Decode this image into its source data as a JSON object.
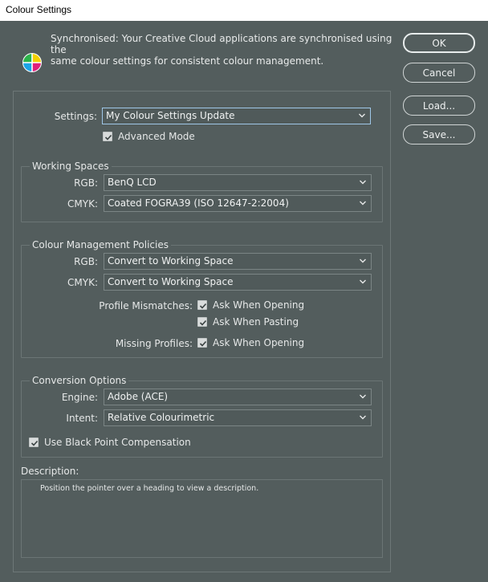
{
  "window": {
    "title": "Colour Settings"
  },
  "sync": {
    "line1": "Synchronised: Your Creative Cloud applications are synchronised using the",
    "line2": "same colour settings for consistent colour management."
  },
  "buttons": {
    "ok": "OK",
    "cancel": "Cancel",
    "load": "Load...",
    "save": "Save..."
  },
  "settings": {
    "label": "Settings:",
    "value": "My Colour Settings Update"
  },
  "advanced_mode": {
    "label": "Advanced Mode",
    "checked": true
  },
  "working_spaces": {
    "title": "Working Spaces",
    "rgb_label": "RGB:",
    "rgb_value": "BenQ LCD",
    "cmyk_label": "CMYK:",
    "cmyk_value": "Coated FOGRA39 (ISO 12647-2:2004)"
  },
  "policies": {
    "title": "Colour Management Policies",
    "rgb_label": "RGB:",
    "rgb_value": "Convert to Working Space",
    "cmyk_label": "CMYK:",
    "cmyk_value": "Convert to Working Space",
    "mismatch_label": "Profile Mismatches:",
    "ask_opening": "Ask When Opening",
    "ask_pasting": "Ask When Pasting",
    "missing_label": "Missing Profiles:",
    "missing_ask_opening": "Ask When Opening"
  },
  "conversion": {
    "title": "Conversion Options",
    "engine_label": "Engine:",
    "engine_value": "Adobe (ACE)",
    "intent_label": "Intent:",
    "intent_value": "Relative Colourimetric",
    "bpc_label": "Use Black Point Compensation"
  },
  "description": {
    "title": "Description:",
    "text": "Position the pointer over a heading to view a description."
  },
  "colors": {
    "background": "#535d5d",
    "titlebar": "#ffffff",
    "focus_border": "#9fc7e8"
  },
  "icons": {
    "sync": "colour-wheel-icon",
    "dropdown": "chevron-down-icon",
    "check": "checkmark-icon"
  }
}
